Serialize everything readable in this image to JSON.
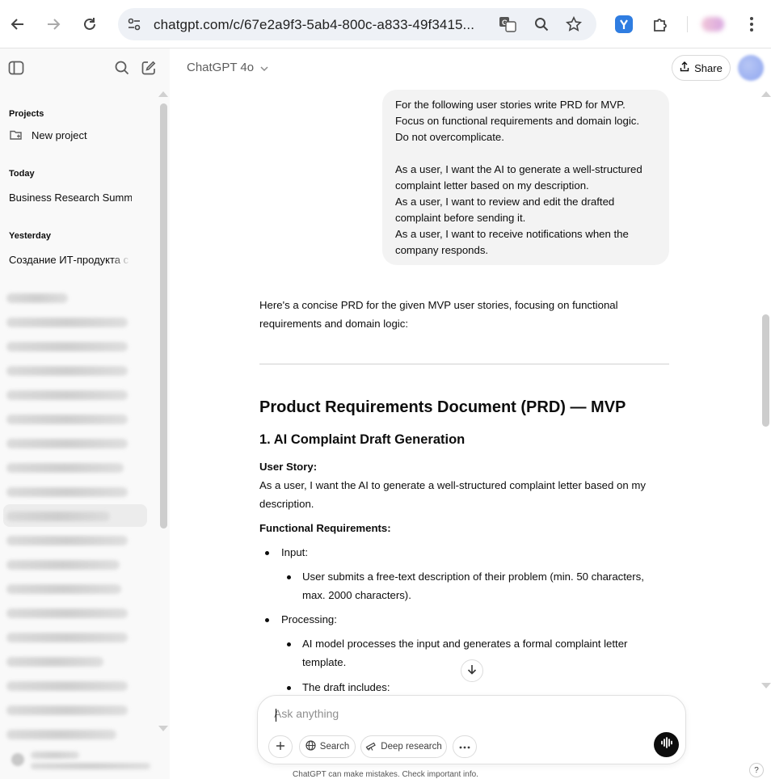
{
  "browser": {
    "url": "chatgpt.com/c/67e2a9f3-5ab4-800c-a833-49f3415..."
  },
  "sidebar": {
    "projects_label": "Projects",
    "new_project": "New project",
    "today_label": "Today",
    "today_items": [
      "Business Research Summary"
    ],
    "yesterday_label": "Yesterday",
    "yesterday_items": [
      "Создание ИТ-продукта с ИИ"
    ]
  },
  "header": {
    "model": "ChatGPT 4o",
    "share": "Share"
  },
  "chat": {
    "user_message": [
      "For the following user stories write PRD for MVP.",
      "Focus on functional requirements and domain logic.",
      "Do not overcomplicate.",
      "",
      "As a user, I want the AI to generate a well-structured",
      "complaint letter based on my description.",
      "As a user, I want to review and edit the drafted",
      "complaint before sending it.",
      "As a user, I want to receive notifications when the",
      "company responds."
    ],
    "intro": [
      "Here's a concise PRD for the given MVP user stories, focusing on functional",
      "requirements and domain logic:"
    ],
    "h1": "Product Requirements Document (PRD) — MVP",
    "h2": "1. AI Complaint Draft Generation",
    "user_story_label": "User Story:",
    "user_story_text": [
      "As a user, I want the AI to generate a well-structured complaint letter based on my",
      "description."
    ],
    "func_req_label": "Functional Requirements:",
    "input_label": "Input:",
    "input_item": [
      "User submits a free-text description of their problem (min. 50 characters,",
      "max. 2000 characters)."
    ],
    "processing_label": "Processing:",
    "processing_item": [
      "AI model processes the input and generates a formal complaint letter",
      "template."
    ],
    "draft_item": "The draft includes:"
  },
  "composer": {
    "placeholder": "Ask anything",
    "search": "Search",
    "deep_research": "Deep research"
  },
  "footer": {
    "disclaimer": "ChatGPT can make mistakes. Check important info.",
    "help": "?"
  }
}
